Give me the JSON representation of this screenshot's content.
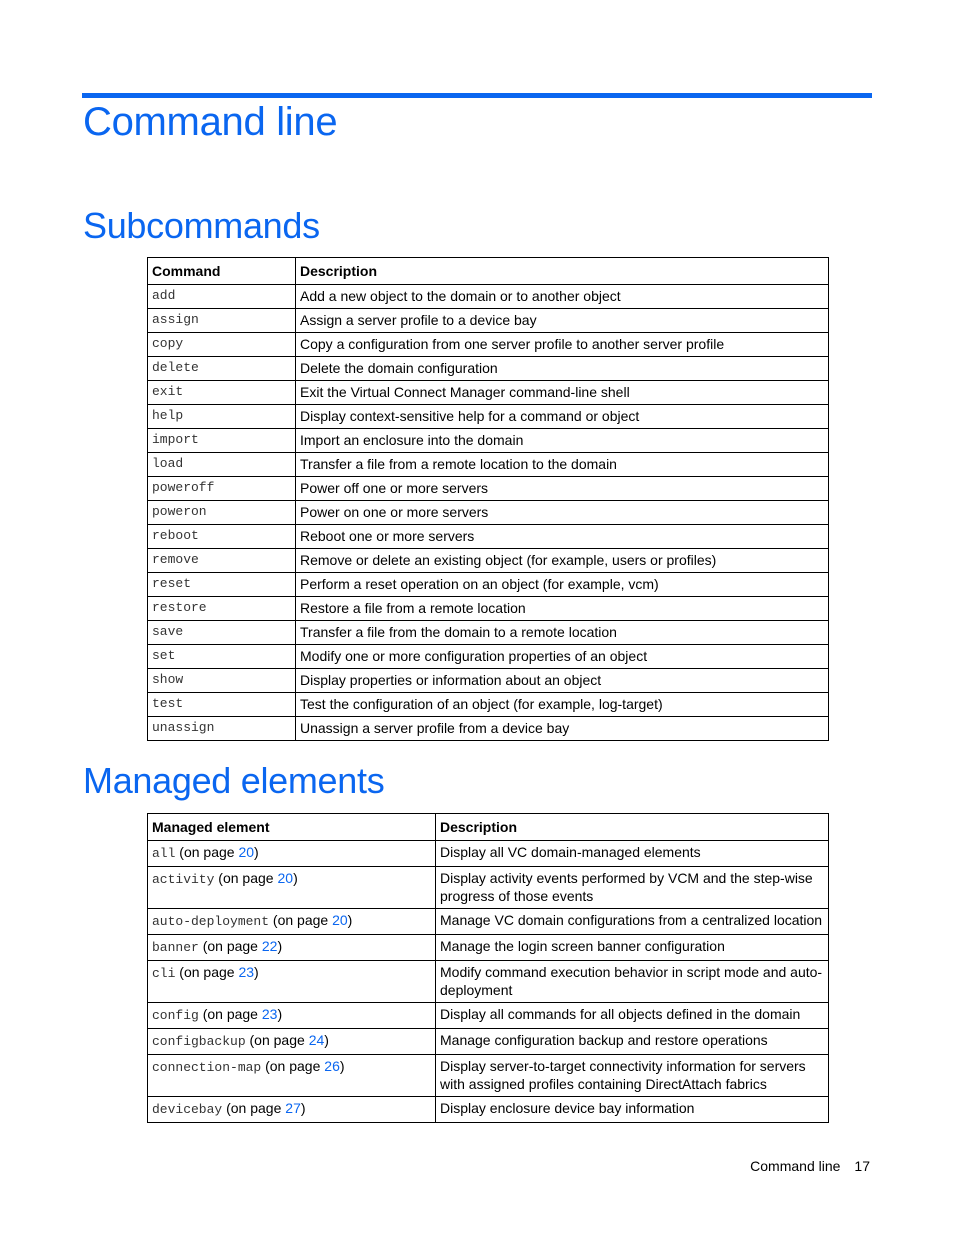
{
  "page": {
    "title": "Command line",
    "accent_color": "#0a66f0"
  },
  "subcommands": {
    "heading": "Subcommands",
    "headers": [
      "Command",
      "Description"
    ],
    "rows": [
      {
        "cmd": "add",
        "desc": "Add a new object to the domain or to another object"
      },
      {
        "cmd": "assign",
        "desc": "Assign a server profile to a device bay"
      },
      {
        "cmd": "copy",
        "desc": "Copy a configuration from one server profile to another server profile"
      },
      {
        "cmd": "delete",
        "desc": "Delete the domain configuration"
      },
      {
        "cmd": "exit",
        "desc": "Exit the Virtual Connect Manager command-line shell"
      },
      {
        "cmd": "help",
        "desc": "Display context-sensitive help for a command or object"
      },
      {
        "cmd": "import",
        "desc": "Import an enclosure into the domain"
      },
      {
        "cmd": "load",
        "desc": "Transfer a file from a remote location to the domain"
      },
      {
        "cmd": "poweroff",
        "desc": "Power off one or more servers"
      },
      {
        "cmd": "poweron",
        "desc": "Power on one or more servers"
      },
      {
        "cmd": "reboot",
        "desc": "Reboot one or more servers"
      },
      {
        "cmd": "remove",
        "desc": "Remove or delete an existing object (for example, users or profiles)"
      },
      {
        "cmd": "reset",
        "desc": "Perform a reset operation on an object (for example, vcm)"
      },
      {
        "cmd": "restore",
        "desc": "Restore a file from a remote location"
      },
      {
        "cmd": "save",
        "desc": "Transfer a file from the domain to a remote location"
      },
      {
        "cmd": "set",
        "desc": "Modify one or more configuration properties of an object"
      },
      {
        "cmd": "show",
        "desc": "Display properties or information about an object"
      },
      {
        "cmd": "test",
        "desc": "Test the configuration of an object (for example, log-target)"
      },
      {
        "cmd": "unassign",
        "desc": "Unassign a server profile from a device bay"
      }
    ]
  },
  "managed": {
    "heading": "Managed elements",
    "headers": [
      "Managed element",
      "Description"
    ],
    "on_page_prefix": " (on page ",
    "on_page_suffix": ")",
    "rows": [
      {
        "el": "all",
        "page": "20",
        "desc": "Display all VC domain-managed elements"
      },
      {
        "el": "activity",
        "page": "20",
        "desc": "Display activity events performed by VCM and the step-wise progress of those events"
      },
      {
        "el": "auto-deployment",
        "page": "20",
        "desc": "Manage VC domain configurations from a centralized location"
      },
      {
        "el": "banner",
        "page": "22",
        "desc": "Manage the login screen banner configuration"
      },
      {
        "el": "cli",
        "page": "23",
        "desc": "Modify command execution behavior in script mode and auto-deployment"
      },
      {
        "el": "config",
        "page": "23",
        "desc": "Display all commands for all objects defined in the domain"
      },
      {
        "el": "configbackup",
        "page": "24",
        "desc": "Manage configuration backup and restore operations"
      },
      {
        "el": "connection-map",
        "page": "26",
        "desc": "Display server-to-target connectivity information for servers with assigned profiles containing DirectAttach fabrics"
      },
      {
        "el": "devicebay",
        "page": "27",
        "desc": "Display enclosure device bay information"
      }
    ]
  },
  "footer": {
    "section": "Command line",
    "page_number": "17"
  }
}
